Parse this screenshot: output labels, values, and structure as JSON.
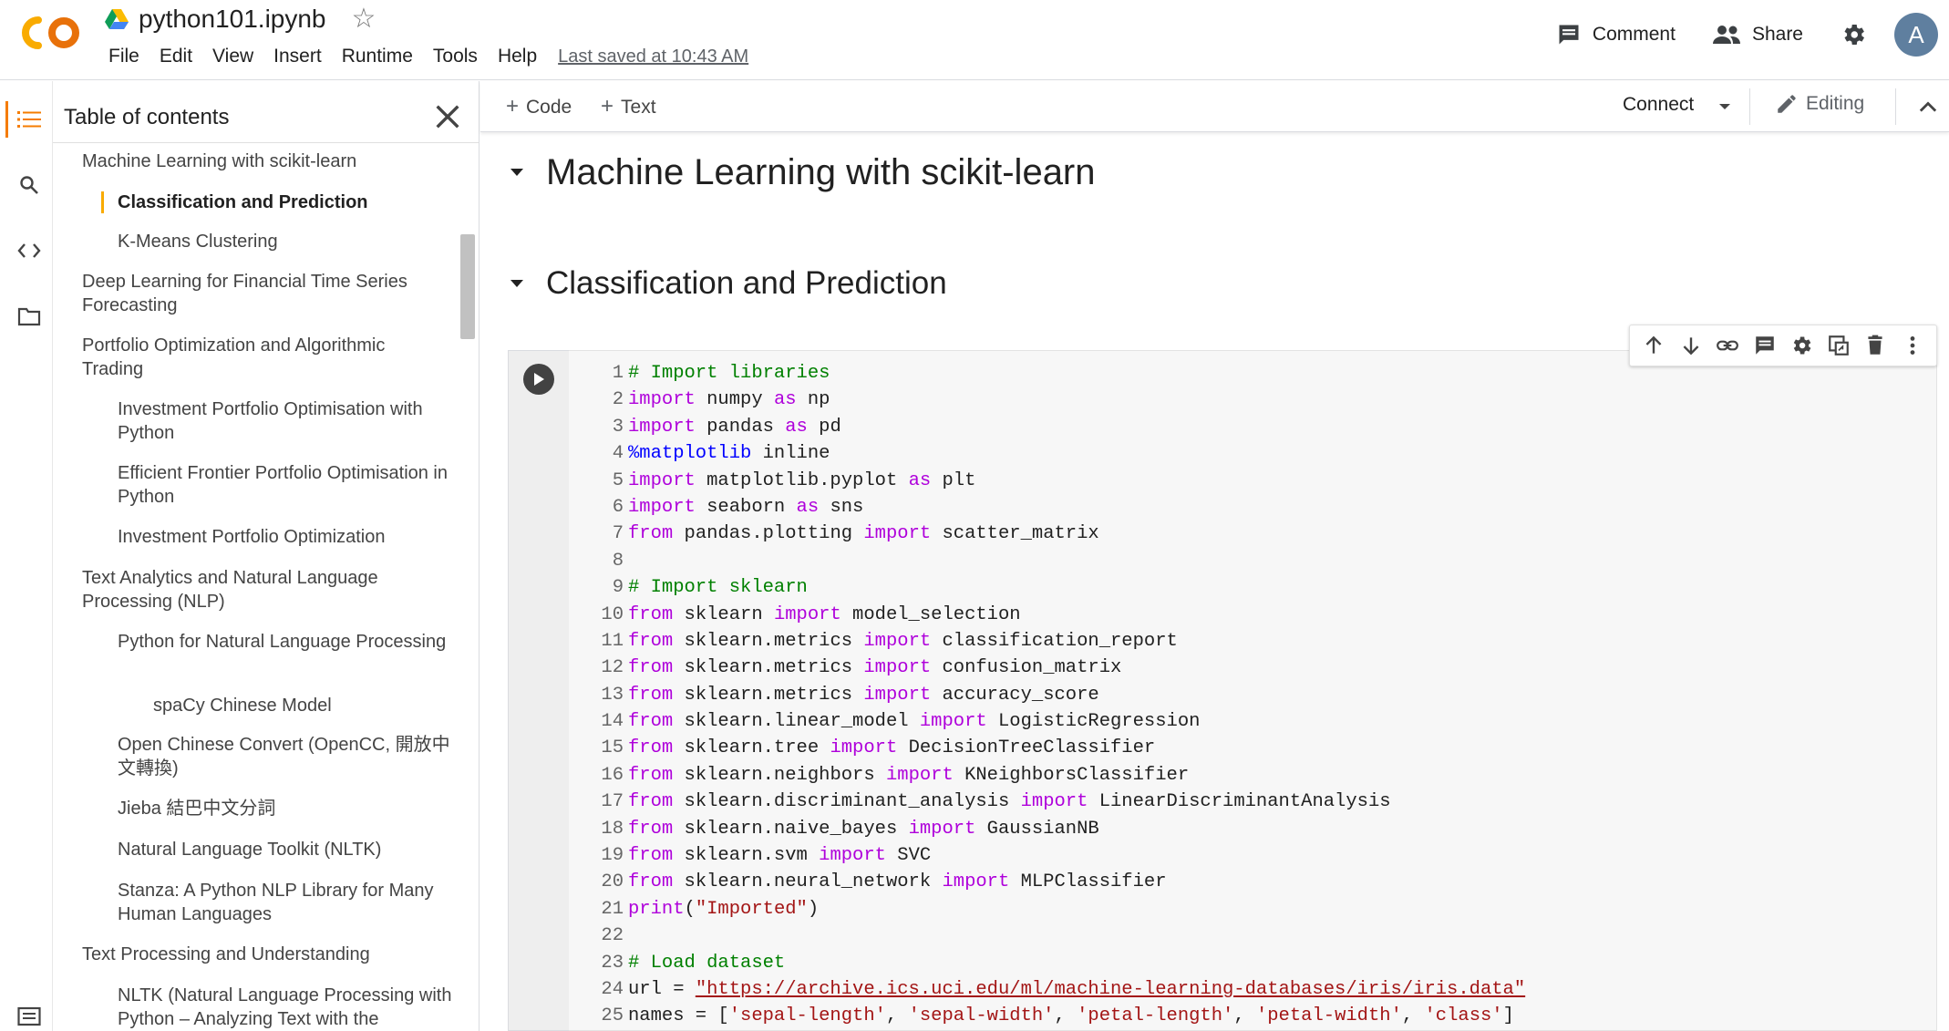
{
  "header": {
    "title": "python101.ipynb",
    "menu": [
      "File",
      "Edit",
      "View",
      "Insert",
      "Runtime",
      "Tools",
      "Help"
    ],
    "last_saved": "Last saved at 10:43 AM",
    "comment_label": "Comment",
    "share_label": "Share",
    "avatar_letter": "A"
  },
  "toc": {
    "title": "Table of contents",
    "items": [
      {
        "label": "Machine Learning with scikit-learn",
        "level": 1
      },
      {
        "label": "Classification and Prediction",
        "level": 2,
        "active": true
      },
      {
        "label": "K-Means Clustering",
        "level": 2
      },
      {
        "label": "Deep Learning for Financial Time Series Forecasting",
        "level": 1
      },
      {
        "label": "Portfolio Optimization and Algorithmic Trading",
        "level": 1
      },
      {
        "label": "Investment Portfolio Optimisation with Python",
        "level": 2
      },
      {
        "label": "Efficient Frontier Portfolio Optimisation in Python",
        "level": 2
      },
      {
        "label": "Investment Portfolio Optimization",
        "level": 2
      },
      {
        "label": "Text Analytics and Natural Language Processing (NLP)",
        "level": 1
      },
      {
        "label": "Python for Natural Language Processing",
        "level": 2
      },
      {
        "label": "spaCy Chinese Model",
        "level": 3
      },
      {
        "label": "Open Chinese Convert (OpenCC, 開放中文轉換)",
        "level": 2
      },
      {
        "label": "Jieba 結巴中文分詞",
        "level": 2
      },
      {
        "label": "Natural Language Toolkit (NLTK)",
        "level": 2
      },
      {
        "label": "Stanza: A Python NLP Library for Many Human Languages",
        "level": 2
      },
      {
        "label": "Text Processing and Understanding",
        "level": 1
      },
      {
        "label": "NLTK (Natural Language Processing with Python – Analyzing Text with the",
        "level": 2
      }
    ]
  },
  "toolbar": {
    "add_code": "Code",
    "add_text": "Text",
    "connect": "Connect",
    "editing": "Editing"
  },
  "main": {
    "heading1": "Machine Learning with scikit-learn",
    "heading2": "Classification and Prediction"
  },
  "code_cell": {
    "lines": [
      [
        [
          "cm",
          "# Import libraries"
        ]
      ],
      [
        [
          "kw",
          "import"
        ],
        [
          "t",
          " numpy "
        ],
        [
          "kw",
          "as"
        ],
        [
          "t",
          " np"
        ]
      ],
      [
        [
          "kw",
          "import"
        ],
        [
          "t",
          " pandas "
        ],
        [
          "kw",
          "as"
        ],
        [
          "t",
          " pd"
        ]
      ],
      [
        [
          "mg",
          "%matplotlib"
        ],
        [
          "t",
          " inline"
        ]
      ],
      [
        [
          "kw",
          "import"
        ],
        [
          "t",
          " matplotlib.pyplot "
        ],
        [
          "kw",
          "as"
        ],
        [
          "t",
          " plt"
        ]
      ],
      [
        [
          "kw",
          "import"
        ],
        [
          "t",
          " seaborn "
        ],
        [
          "kw",
          "as"
        ],
        [
          "t",
          " sns"
        ]
      ],
      [
        [
          "kw",
          "from"
        ],
        [
          "t",
          " pandas.plotting "
        ],
        [
          "kw",
          "import"
        ],
        [
          "t",
          " scatter_matrix"
        ]
      ],
      [],
      [
        [
          "cm",
          "# Import sklearn"
        ]
      ],
      [
        [
          "kw",
          "from"
        ],
        [
          "t",
          " sklearn "
        ],
        [
          "kw",
          "import"
        ],
        [
          "t",
          " model_selection"
        ]
      ],
      [
        [
          "kw",
          "from"
        ],
        [
          "t",
          " sklearn.metrics "
        ],
        [
          "kw",
          "import"
        ],
        [
          "t",
          " classification_report"
        ]
      ],
      [
        [
          "kw",
          "from"
        ],
        [
          "t",
          " sklearn.metrics "
        ],
        [
          "kw",
          "import"
        ],
        [
          "t",
          " confusion_matrix"
        ]
      ],
      [
        [
          "kw",
          "from"
        ],
        [
          "t",
          " sklearn.metrics "
        ],
        [
          "kw",
          "import"
        ],
        [
          "t",
          " accuracy_score"
        ]
      ],
      [
        [
          "kw",
          "from"
        ],
        [
          "t",
          " sklearn.linear_model "
        ],
        [
          "kw",
          "import"
        ],
        [
          "t",
          " LogisticRegression"
        ]
      ],
      [
        [
          "kw",
          "from"
        ],
        [
          "t",
          " sklearn.tree "
        ],
        [
          "kw",
          "import"
        ],
        [
          "t",
          " DecisionTreeClassifier"
        ]
      ],
      [
        [
          "kw",
          "from"
        ],
        [
          "t",
          " sklearn.neighbors "
        ],
        [
          "kw",
          "import"
        ],
        [
          "t",
          " KNeighborsClassifier"
        ]
      ],
      [
        [
          "kw",
          "from"
        ],
        [
          "t",
          " sklearn.discriminant_analysis "
        ],
        [
          "kw",
          "import"
        ],
        [
          "t",
          " LinearDiscriminantAnalysis"
        ]
      ],
      [
        [
          "kw",
          "from"
        ],
        [
          "t",
          " sklearn.naive_bayes "
        ],
        [
          "kw",
          "import"
        ],
        [
          "t",
          " GaussianNB"
        ]
      ],
      [
        [
          "kw",
          "from"
        ],
        [
          "t",
          " sklearn.svm "
        ],
        [
          "kw",
          "import"
        ],
        [
          "t",
          " SVC"
        ]
      ],
      [
        [
          "kw",
          "from"
        ],
        [
          "t",
          " sklearn.neural_network "
        ],
        [
          "kw",
          "import"
        ],
        [
          "t",
          " MLPClassifier"
        ]
      ],
      [
        [
          "kw",
          "print"
        ],
        [
          "t",
          "("
        ],
        [
          "str",
          "\"Imported\""
        ],
        [
          "t",
          ")"
        ]
      ],
      [],
      [
        [
          "cm",
          "# Load dataset"
        ]
      ],
      [
        [
          "t",
          "url = "
        ],
        [
          "url",
          "\"https://archive.ics.uci.edu/ml/machine-learning-databases/iris/iris.data\""
        ]
      ],
      [
        [
          "t",
          "names = ["
        ],
        [
          "str",
          "'sepal-length'"
        ],
        [
          "t",
          ", "
        ],
        [
          "str",
          "'sepal-width'"
        ],
        [
          "t",
          ", "
        ],
        [
          "str",
          "'petal-length'"
        ],
        [
          "t",
          ", "
        ],
        [
          "str",
          "'petal-width'"
        ],
        [
          "t",
          ", "
        ],
        [
          "str",
          "'class'"
        ],
        [
          "t",
          "]"
        ]
      ]
    ]
  },
  "colors": {
    "accent": "#f57c00",
    "active_marker": "#f9ab00",
    "keyword": "#af00db",
    "comment": "#008000",
    "string": "#a31515",
    "magic": "#0000ff"
  }
}
